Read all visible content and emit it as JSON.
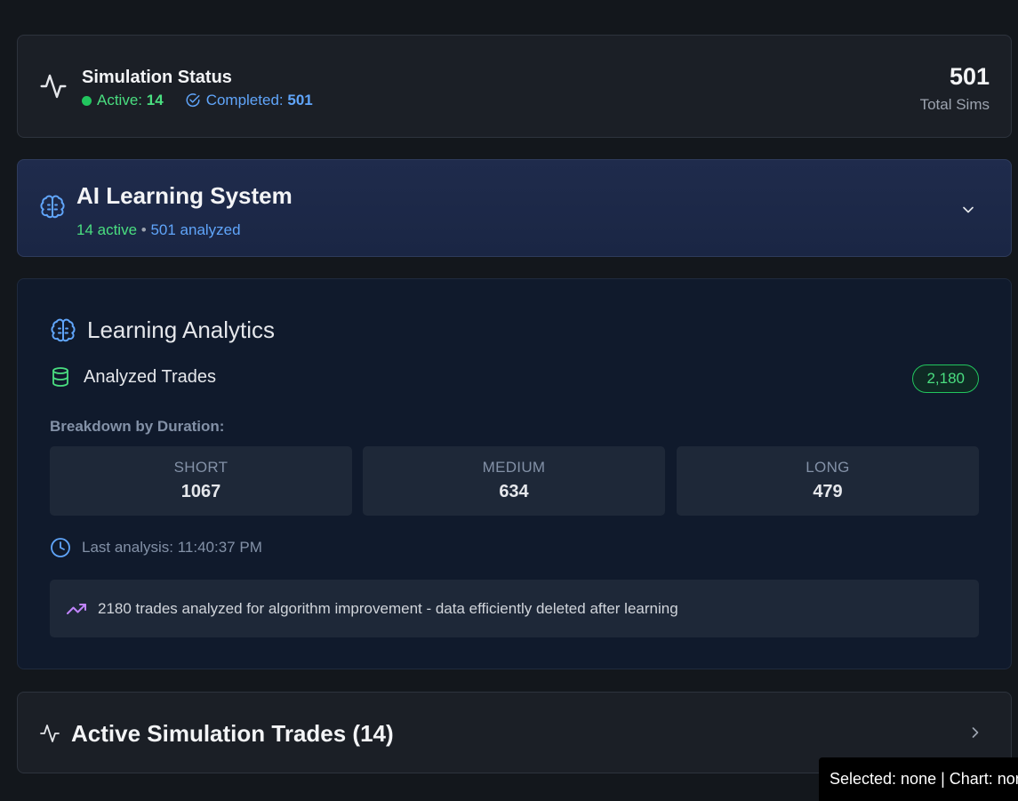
{
  "status": {
    "title": "Simulation Status",
    "active_label": "Active:",
    "active_value": "14",
    "completed_label": "Completed:",
    "completed_value": "501",
    "total_value": "501",
    "total_label": "Total Sims",
    "icon": "activity-icon"
  },
  "ai": {
    "title": "AI Learning System",
    "active_text": "14 active",
    "separator": " • ",
    "analyzed_text": "501 analyzed",
    "icon": "brain-icon"
  },
  "analytics": {
    "title": "Learning Analytics",
    "trades_label": "Analyzed Trades",
    "trades_badge": "2,180",
    "breakdown_label": "Breakdown by Duration:",
    "durations": [
      {
        "label": "SHORT",
        "value": "1067"
      },
      {
        "label": "MEDIUM",
        "value": "634"
      },
      {
        "label": "LONG",
        "value": "479"
      }
    ],
    "last_analysis": "Last analysis: 11:40:37 PM",
    "note": "2180 trades analyzed for algorithm improvement - data efficiently deleted after learning"
  },
  "trades": {
    "title": "Active Simulation Trades (14)"
  },
  "tooltip": {
    "text": "Selected: none | Chart: none"
  },
  "colors": {
    "background": "#13171c",
    "green": "#4ade80",
    "blue": "#60a5fa",
    "purple": "#c084fc"
  }
}
